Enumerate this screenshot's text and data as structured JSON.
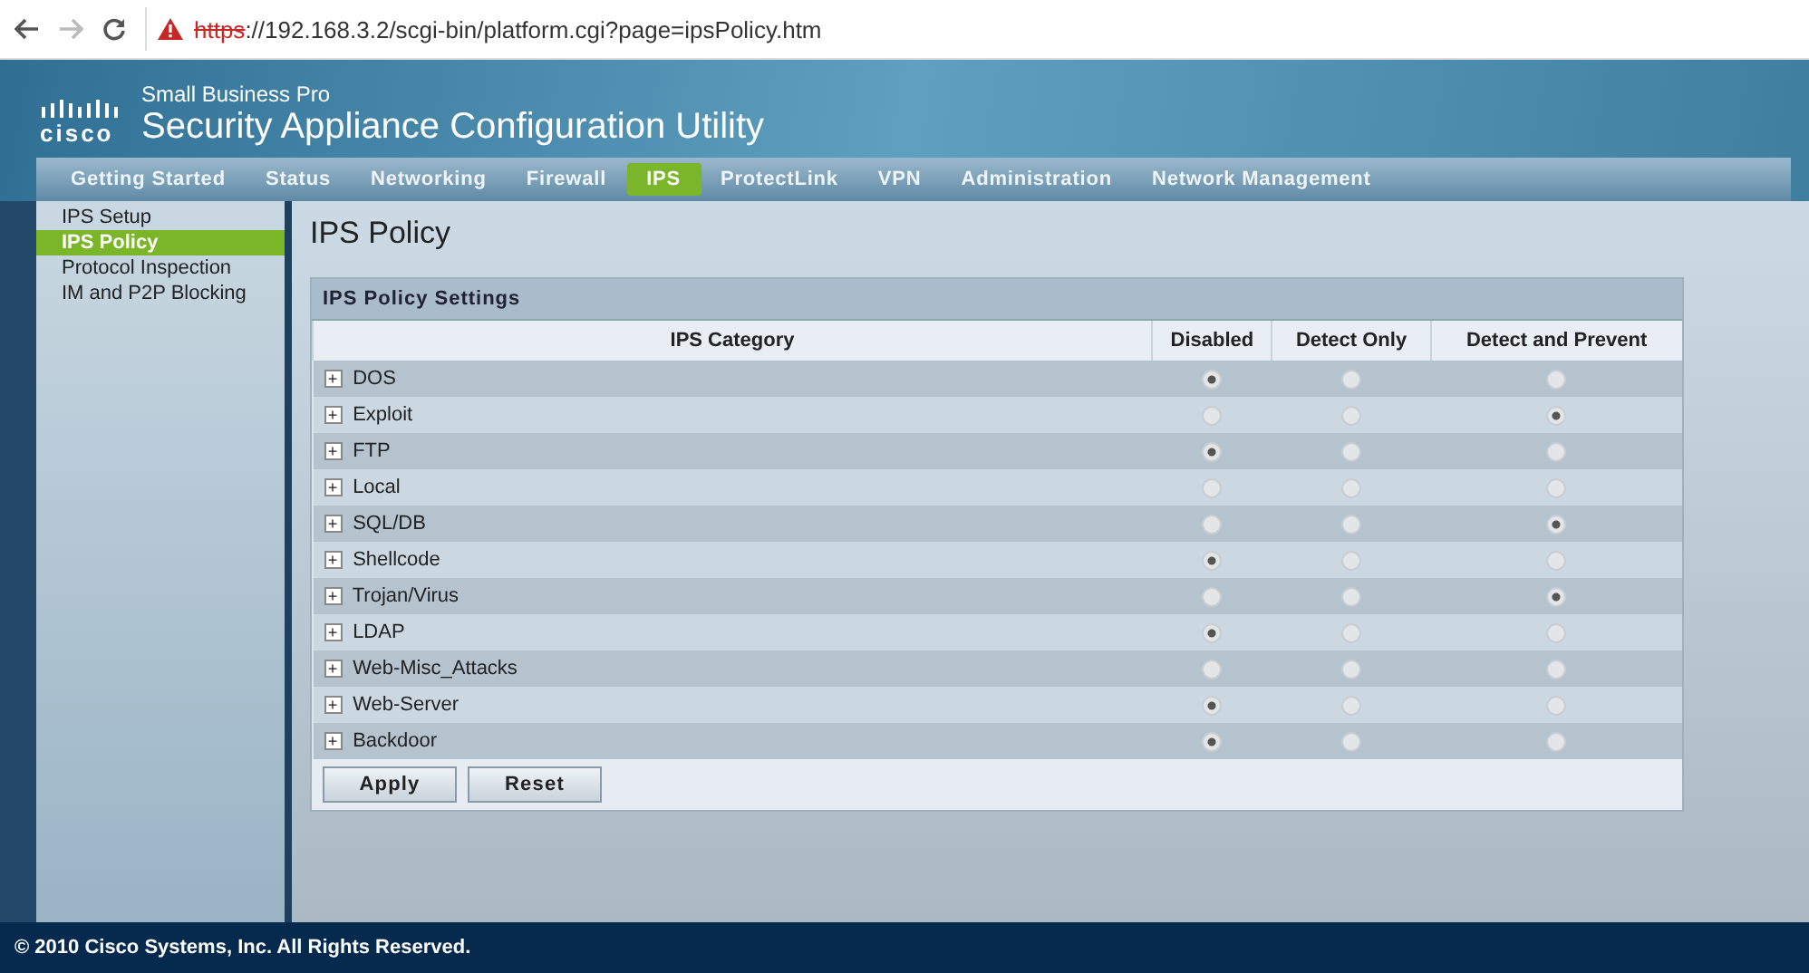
{
  "browser": {
    "url_scheme": "https",
    "url_rest": "://192.168.3.2/scgi-bin/platform.cgi?page=ipsPolicy.htm",
    "insecure": true
  },
  "header": {
    "brand": "cisco",
    "subtitle": "Small Business Pro",
    "title": "Security Appliance Configuration Utility"
  },
  "nav": [
    {
      "label": "Getting Started",
      "selected": false
    },
    {
      "label": "Status",
      "selected": false
    },
    {
      "label": "Networking",
      "selected": false
    },
    {
      "label": "Firewall",
      "selected": false
    },
    {
      "label": "IPS",
      "selected": true
    },
    {
      "label": "ProtectLink",
      "selected": false
    },
    {
      "label": "VPN",
      "selected": false
    },
    {
      "label": "Administration",
      "selected": false
    },
    {
      "label": "Network Management",
      "selected": false
    }
  ],
  "sidebar": {
    "items": [
      {
        "label": "IPS Setup",
        "selected": false
      },
      {
        "label": "IPS Policy",
        "selected": true
      },
      {
        "label": "Protocol Inspection",
        "selected": false
      },
      {
        "label": "IM and P2P Blocking",
        "selected": false
      }
    ]
  },
  "page_title": "IPS Policy",
  "panel": {
    "title": "IPS Policy Settings",
    "columns": [
      "IPS Category",
      "Disabled",
      "Detect Only",
      "Detect and Prevent"
    ],
    "rows": [
      {
        "name": "DOS",
        "expander": "+",
        "options": [
          {
            "selected": true
          },
          {
            "selected": false
          },
          {
            "selected": false
          }
        ]
      },
      {
        "name": "Exploit",
        "expander": "+",
        "options": [
          {
            "selected": false
          },
          {
            "selected": false
          },
          {
            "selected": true
          }
        ]
      },
      {
        "name": "FTP",
        "expander": "+",
        "options": [
          {
            "selected": true
          },
          {
            "selected": false
          },
          {
            "selected": false
          }
        ]
      },
      {
        "name": "Local",
        "expander": "+",
        "options": [
          {
            "selected": false
          },
          {
            "selected": false
          },
          {
            "selected": false
          }
        ]
      },
      {
        "name": "SQL/DB",
        "expander": "+",
        "options": [
          {
            "selected": false
          },
          {
            "selected": false
          },
          {
            "selected": true
          }
        ]
      },
      {
        "name": "Shellcode",
        "expander": "+",
        "options": [
          {
            "selected": true
          },
          {
            "selected": false
          },
          {
            "selected": false
          }
        ]
      },
      {
        "name": "Trojan/Virus",
        "expander": "+",
        "options": [
          {
            "selected": false
          },
          {
            "selected": false
          },
          {
            "selected": true
          }
        ]
      },
      {
        "name": "LDAP",
        "expander": "+",
        "options": [
          {
            "selected": true
          },
          {
            "selected": false
          },
          {
            "selected": false
          }
        ]
      },
      {
        "name": "Web-Misc_Attacks",
        "expander": "+",
        "options": [
          {
            "selected": false
          },
          {
            "selected": false
          },
          {
            "selected": false
          }
        ]
      },
      {
        "name": "Web-Server",
        "expander": "+",
        "options": [
          {
            "selected": true
          },
          {
            "selected": false
          },
          {
            "selected": false
          }
        ]
      },
      {
        "name": "Backdoor",
        "expander": "+",
        "options": [
          {
            "selected": true
          },
          {
            "selected": false
          },
          {
            "selected": false
          }
        ]
      }
    ],
    "buttons": [
      "Apply",
      "Reset"
    ]
  },
  "footer": "© 2010 Cisco Systems, Inc. All Rights Reserved."
}
